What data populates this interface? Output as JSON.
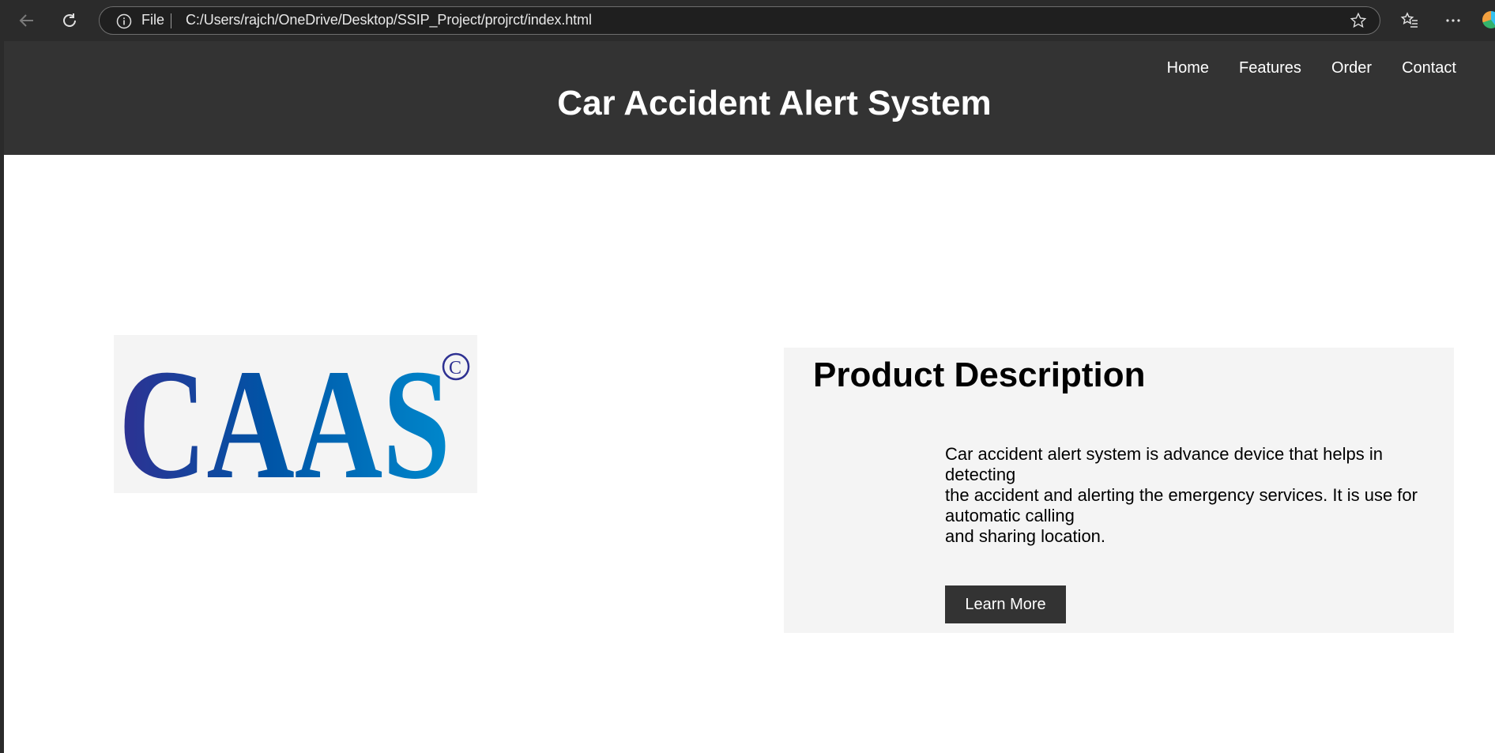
{
  "browser": {
    "scheme_label": "File",
    "url": "C:/Users/rajch/OneDrive/Desktop/SSIP_Project/projrct/index.html",
    "icons": [
      "back-icon",
      "reload-icon",
      "info-icon",
      "star-icon",
      "favorites-icon",
      "more-icon"
    ]
  },
  "header": {
    "title": "Car Accident Alert System",
    "nav": [
      "Home",
      "Features",
      "Order",
      "Contact"
    ],
    "background": "#333333"
  },
  "logo": {
    "text": "CAAS",
    "mark": "©",
    "colors": [
      "#2e3192",
      "#0054a6",
      "#0072bc",
      "#0088cc"
    ]
  },
  "description": {
    "title": "Product Description",
    "lines": [
      "Car accident alert system is advance device that helps in",
      "detecting",
      "the accident and alerting the emergency services. It is use for",
      "automatic calling",
      "and sharing location."
    ],
    "button_label": "Learn More"
  }
}
